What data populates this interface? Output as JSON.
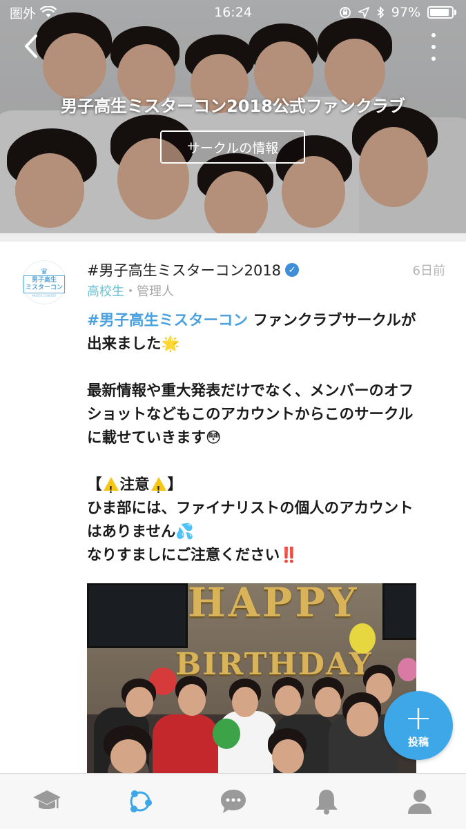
{
  "status_bar": {
    "carrier": "圏外",
    "time": "16:24",
    "battery": "97%",
    "battery_level": 0.97
  },
  "header": {
    "circle_title": "男子高生ミスターコン2018公式ファンクラブ",
    "info_button": "サークルの情報",
    "back_icon": "chevron-left-icon",
    "more_icon": "more-vertical-icon"
  },
  "post": {
    "avatar_logo": {
      "line1": "男子高生",
      "line2": "ミスターコン",
      "small": "MISTER CONTEST"
    },
    "username": "#男子高生ミスターコン2018",
    "verified_icon": "verified-badge-icon",
    "time_ago": "6日前",
    "role_school": "高校生",
    "role_separator": "・",
    "role_admin": "管理人",
    "body": {
      "hashtag": "#男子高生ミスターコン",
      "line1_rest": " ファンクラブサークルが",
      "line2": "出来ました",
      "line2_emoji": "🌟",
      "line3": "最新情報や重大発表だけでなく、メンバーのオフ",
      "line4": "ショットなどもこのアカウントからこのサークル",
      "line5": "に載せていきます",
      "line5_emoji": "😳",
      "line6_open": "【",
      "line6_text": "注意",
      "line6_close": "】",
      "line7": "ひま部には、ファイナリストの個人のアカウント",
      "line8": "はありません",
      "line8_emoji": "💦",
      "line9": "なりすましにご注意ください",
      "line9_emoji": "‼️"
    },
    "photo": {
      "banner_top": "HAPPY",
      "banner_bottom": "BIRTHDAY"
    }
  },
  "fab": {
    "label": "投稿",
    "icon": "plus-icon",
    "color": "#3ea7e8"
  },
  "tab_bar": {
    "tabs": [
      {
        "icon": "graduation-cap-icon",
        "active": false
      },
      {
        "icon": "circle-network-icon",
        "active": true
      },
      {
        "icon": "chat-bubble-icon",
        "active": false
      },
      {
        "icon": "bell-icon",
        "active": false
      },
      {
        "icon": "profile-icon",
        "active": false
      }
    ],
    "active_color": "#3ea7e8",
    "inactive_color": "#9a9a9a"
  },
  "colors": {
    "hashtag": "#4aa1df",
    "school": "#6ac2d4",
    "meta_gray": "#a6a6a6"
  }
}
